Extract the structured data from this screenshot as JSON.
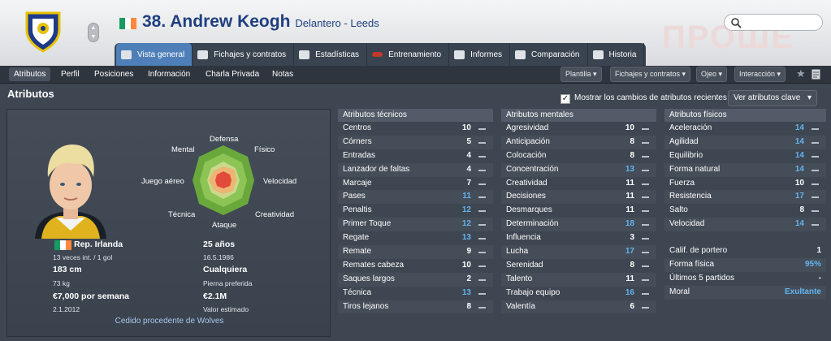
{
  "header": {
    "title": "38. Andrew Keogh",
    "subtitle": "Delantero - Leeds",
    "search_placeholder": "",
    "watermark": "ПРОШЕ"
  },
  "tabs": [
    {
      "label": "Vista general",
      "icon": "overview-icon",
      "active": true
    },
    {
      "label": "Fichajes y contratos",
      "icon": "contract-icon",
      "active": false
    },
    {
      "label": "Estadísticas",
      "icon": "stats-icon",
      "active": false
    },
    {
      "label": "Entrenamiento",
      "icon": "training-icon",
      "active": false
    },
    {
      "label": "Informes",
      "icon": "report-icon",
      "active": false
    },
    {
      "label": "Comparación",
      "icon": "compare-icon",
      "active": false
    },
    {
      "label": "Historia",
      "icon": "history-icon",
      "active": false
    }
  ],
  "subnav": {
    "items": [
      {
        "label": "Atributos",
        "active": true
      },
      {
        "label": "Perfil"
      },
      {
        "label": "Posiciones"
      },
      {
        "label": "Información"
      },
      {
        "label": "Charla Privada"
      },
      {
        "label": "Notas"
      }
    ],
    "dropdowns": [
      "Plantilla",
      "Fichajes y contratos",
      "Ojeo",
      "Interacción"
    ]
  },
  "section": {
    "title": "Atributos",
    "checkbox_label": "Mostrar los cambios de atributos recientes",
    "view_button": "Ver atributos clave"
  },
  "radar": {
    "labels": [
      "Defensa",
      "Físico",
      "Velocidad",
      "Creatividad",
      "Ataque",
      "Técnica",
      "Juego aéreo",
      "Mental"
    ]
  },
  "profile": {
    "nationality": "Rep. Irlanda",
    "caps": "13 veces int. / 1 gol",
    "age": "25 años",
    "dob": "16.5.1986",
    "height": "183 cm",
    "preferred_foot": "Cualquiera",
    "preferred_foot_label": "Pierna preferida",
    "weight": "73 kg",
    "wage": "€7,000 por semana",
    "value": "€2.1M",
    "value_label": "Valor estimado",
    "contract_date": "2.1.2012",
    "loan": "Cedido procedente de Wolves"
  },
  "colors": {
    "flag_green": "#169b62",
    "flag_white": "#ffffff",
    "flag_orange": "#ff883e",
    "highlight": "#63b4f0",
    "title_blue": "#1f3f80"
  },
  "attributes": {
    "technical": {
      "header": "Atributos técnicos",
      "rows": [
        {
          "name": "Centros",
          "value": "10",
          "hl": false
        },
        {
          "name": "Córners",
          "value": "5",
          "hl": false
        },
        {
          "name": "Entradas",
          "value": "4",
          "hl": false
        },
        {
          "name": "Lanzador de faltas",
          "value": "4",
          "hl": false
        },
        {
          "name": "Marcaje",
          "value": "7",
          "hl": false
        },
        {
          "name": "Pases",
          "value": "11",
          "hl": true
        },
        {
          "name": "Penaltis",
          "value": "12",
          "hl": true
        },
        {
          "name": "Primer Toque",
          "value": "12",
          "hl": true
        },
        {
          "name": "Regate",
          "value": "13",
          "hl": true
        },
        {
          "name": "Remate",
          "value": "9",
          "hl": false
        },
        {
          "name": "Remates cabeza",
          "value": "10",
          "hl": false
        },
        {
          "name": "Saques largos",
          "value": "2",
          "hl": false
        },
        {
          "name": "Técnica",
          "value": "13",
          "hl": true
        },
        {
          "name": "Tiros lejanos",
          "value": "8",
          "hl": false
        }
      ]
    },
    "mental": {
      "header": "Atributos mentales",
      "rows": [
        {
          "name": "Agresividad",
          "value": "10",
          "hl": false
        },
        {
          "name": "Anticipación",
          "value": "8",
          "hl": false
        },
        {
          "name": "Colocación",
          "value": "8",
          "hl": false
        },
        {
          "name": "Concentración",
          "value": "13",
          "hl": true
        },
        {
          "name": "Creatividad",
          "value": "11",
          "hl": false
        },
        {
          "name": "Decisiones",
          "value": "11",
          "hl": false
        },
        {
          "name": "Desmarques",
          "value": "11",
          "hl": false
        },
        {
          "name": "Determinación",
          "value": "18",
          "hl": true
        },
        {
          "name": "Influencia",
          "value": "3",
          "hl": false
        },
        {
          "name": "Lucha",
          "value": "17",
          "hl": true
        },
        {
          "name": "Serenidad",
          "value": "8",
          "hl": false
        },
        {
          "name": "Talento",
          "value": "11",
          "hl": false
        },
        {
          "name": "Trabajo equipo",
          "value": "16",
          "hl": true
        },
        {
          "name": "Valentía",
          "value": "6",
          "hl": false
        }
      ]
    },
    "physical": {
      "header": "Atributos físicos",
      "rows": [
        {
          "name": "Aceleración",
          "value": "14",
          "hl": true
        },
        {
          "name": "Agilidad",
          "value": "14",
          "hl": true
        },
        {
          "name": "Equilibrio",
          "value": "14",
          "hl": true
        },
        {
          "name": "Forma natural",
          "value": "14",
          "hl": true
        },
        {
          "name": "Fuerza",
          "value": "10",
          "hl": false
        },
        {
          "name": "Resistencia",
          "value": "17",
          "hl": true
        },
        {
          "name": "Salto",
          "value": "8",
          "hl": false
        },
        {
          "name": "Velocidad",
          "value": "14",
          "hl": true
        }
      ],
      "extra": [
        {
          "name": "Calif. de portero",
          "value": "1",
          "hl": false
        },
        {
          "name": "Forma física",
          "value": "95%",
          "hl": true
        },
        {
          "name": "Últimos 5 partidos",
          "value": "-",
          "hl": false
        },
        {
          "name": "Moral",
          "value": "Exultante",
          "hl": true
        }
      ]
    }
  }
}
